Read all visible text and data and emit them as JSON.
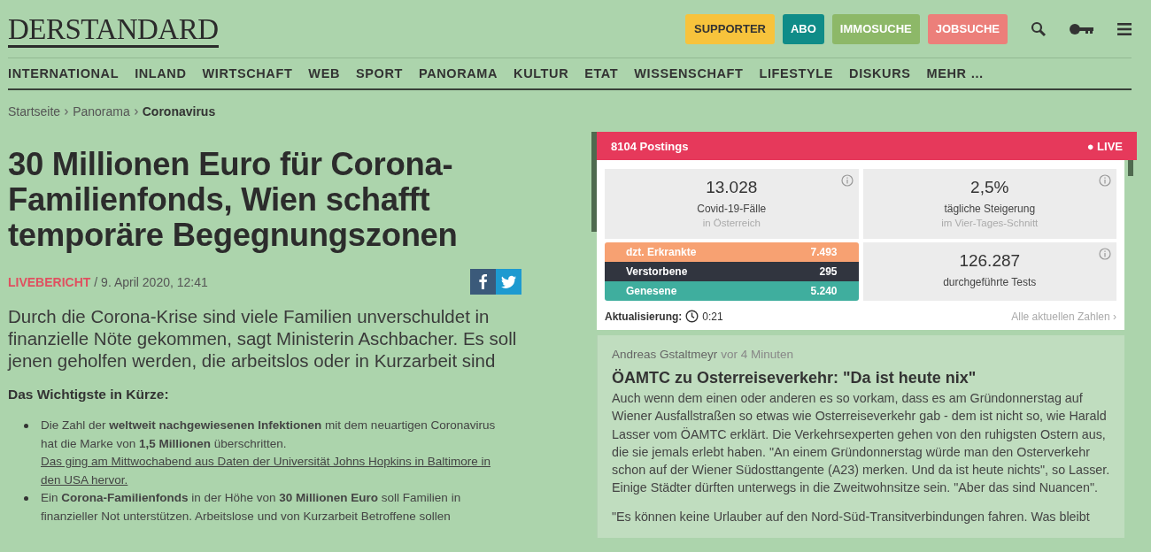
{
  "header": {
    "logo": "DERSTANDARD",
    "buttons": [
      {
        "label": "SUPPORTER",
        "color": "#f7c33c"
      },
      {
        "label": "ABO",
        "color": "#0f8c88"
      },
      {
        "label": "IMMOSUCHE",
        "color": "#8db868"
      },
      {
        "label": "JOBSUCHE",
        "color": "#ec7f7a"
      }
    ]
  },
  "nav": [
    "INTERNATIONAL",
    "INLAND",
    "WIRTSCHAFT",
    "WEB",
    "SPORT",
    "PANORAMA",
    "KULTUR",
    "ETAT",
    "WISSENSCHAFT",
    "LIFESTYLE",
    "DISKURS",
    "MEHR …"
  ],
  "breadcrumb": [
    {
      "label": "Startseite",
      "current": false
    },
    {
      "label": "Panorama",
      "current": false
    },
    {
      "label": "Coronavirus",
      "current": true
    }
  ],
  "article": {
    "title": "30 Millionen Euro für Corona-Familienfonds, Wien schafft temporäre Begegnungszonen",
    "kicker": "LIVEBERICHT",
    "date": "/ 9. April 2020, 12:41",
    "lead": "Durch die Corona-Krise sind viele Familien unverschuldet in finanzielle Nöte gekommen, sagt Ministerin Aschbacher. Es soll jenen geholfen werden, die arbeitslos oder in Kurzarbeit sind",
    "summary_title": "Das Wichtigste in Kürze:",
    "bullets": [
      {
        "text": "Die Zahl der **weltweit nachgewiesenen Infektionen** mit dem neuartigen Coronavirus hat die Marke von **1,5 Millionen** überschritten.",
        "link": "Das ging am Mittwochabend aus Daten der Universität Johns Hopkins in Baltimore in den USA hervor."
      },
      {
        "text": "Ein **Corona-Familienfonds** in der Höhe von **30 Millionen Euro** soll Familien in finanzieller Not unterstützen. Arbeitslose und von Kurzarbeit Betroffene sollen"
      }
    ]
  },
  "live": {
    "postings": "8104 Postings",
    "live_label": "● LIVE",
    "stats": [
      {
        "value": "13.028",
        "label": "Covid-19-Fälle",
        "sub": "in Österreich"
      },
      {
        "value": "2,5%",
        "label": "tägliche Steigerung",
        "sub": "im Vier-Tages-Schnitt"
      }
    ],
    "bars": [
      {
        "label": "dzt. Erkrankte",
        "value": "7.493",
        "color": "#f7a172"
      },
      {
        "label": "Verstorbene",
        "value": "295",
        "color": "#31353f"
      },
      {
        "label": "Genesene",
        "value": "5.240",
        "color": "#3fae9e"
      }
    ],
    "tests": {
      "value": "126.287",
      "label": "durchgeführte Tests"
    },
    "update_label": "Aktualisierung:",
    "update_time": "0:21",
    "all_link": "Alle aktuellen Zahlen ›"
  },
  "post": {
    "author": "Andreas Gstaltmeyr",
    "time": "vor 4 Minuten",
    "title": "ÖAMTC zu Osterreiseverkehr: \"Da ist heute nix\"",
    "body": "Auch wenn dem einen oder anderen es so vorkam, dass es am Gründonnerstag auf Wiener Ausfallstraßen so etwas wie Osterreiseverkehr gab - dem ist nicht so, wie Harald Lasser vom ÖAMTC erklärt. Die Verkehrsexperten gehen von den ruhigsten Ostern aus, die sie jemals erlebt haben. \"An einem Gründonnerstag würde man den Osterverkehr schon auf der Wiener Südosttangente (A23) merken. Und da ist heute nichts\", so Lasser. Einige Städter dürften unterwegs in die Zweitwohnsitze sein. \"Aber das sind Nuancen\".",
    "body2": "\"Es können keine Urlauber auf den Nord-Süd-Transitverbindungen fahren. Was bleibt"
  }
}
